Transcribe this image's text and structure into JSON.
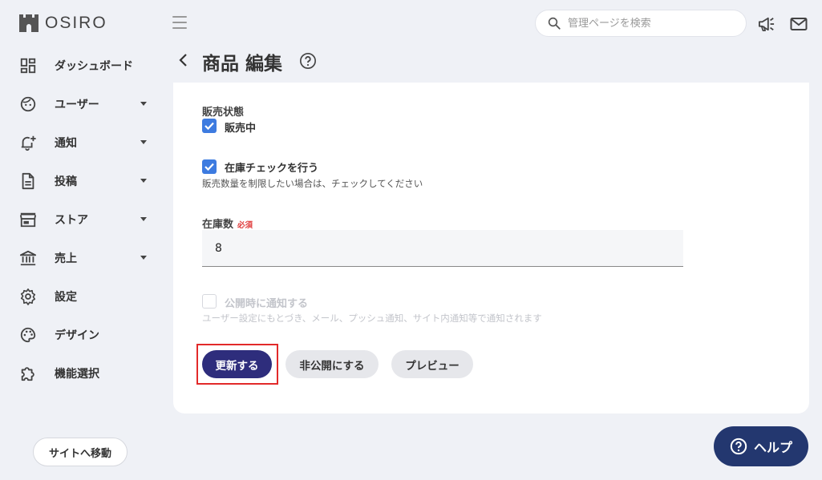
{
  "app": {
    "logo_text": "OSIRO"
  },
  "header": {
    "search_placeholder": "管理ページを検索"
  },
  "sidebar": {
    "items": [
      {
        "label": "ダッシュボード",
        "icon": "dashboard-icon",
        "has_submenu": false
      },
      {
        "label": "ユーザー",
        "icon": "user-face-icon",
        "has_submenu": true
      },
      {
        "label": "通知",
        "icon": "bell-plus-icon",
        "has_submenu": true
      },
      {
        "label": "投稿",
        "icon": "document-icon",
        "has_submenu": true
      },
      {
        "label": "ストア",
        "icon": "store-icon",
        "has_submenu": true
      },
      {
        "label": "売上",
        "icon": "bank-icon",
        "has_submenu": true
      },
      {
        "label": "設定",
        "icon": "gear-icon",
        "has_submenu": false
      },
      {
        "label": "デザイン",
        "icon": "palette-icon",
        "has_submenu": false
      },
      {
        "label": "機能選択",
        "icon": "puzzle-icon",
        "has_submenu": false
      }
    ],
    "site_button": "サイトへ移動"
  },
  "page": {
    "title": "商品 編集"
  },
  "form": {
    "sales_status": {
      "label": "販売状態",
      "checkbox_label": "販売中",
      "checked": true
    },
    "inventory_check": {
      "label": "在庫チェックを行う",
      "checked": true,
      "hint": "販売数量を制限したい場合は、チェックしてください"
    },
    "stock": {
      "label": "在庫数",
      "required": "必須",
      "value": "8"
    },
    "notify": {
      "label": "公開時に通知する",
      "checked": false,
      "disabled": true,
      "hint": "ユーザー設定にもとづき、メール、プッシュ通知、サイト内通知等で通知されます"
    }
  },
  "actions": {
    "update": "更新する",
    "unpublish": "非公開にする",
    "preview": "プレビュー"
  },
  "help": {
    "label": "ヘルプ"
  },
  "colors": {
    "primary": "#2e2d7c",
    "checkbox": "#3d7be0",
    "help": "#23376f",
    "highlight": "#e22a2a",
    "required": "#e03c3c"
  }
}
